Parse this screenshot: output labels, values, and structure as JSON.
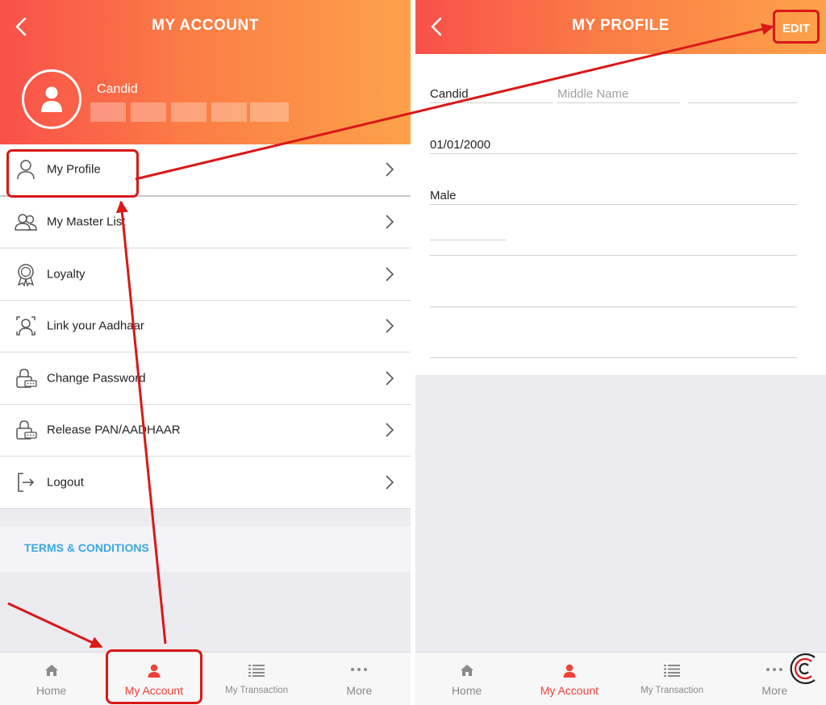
{
  "account_screen": {
    "title": "MY ACCOUNT",
    "user_name": "Candid",
    "menu": [
      {
        "label": "My Profile",
        "icon": "person-icon"
      },
      {
        "label": "My Master List",
        "icon": "users-icon"
      },
      {
        "label": "Loyalty",
        "icon": "badge-icon"
      },
      {
        "label": "Link your Aadhaar",
        "icon": "aadhaar-icon"
      },
      {
        "label": "Change Password",
        "icon": "lock-icon"
      },
      {
        "label": "Release PAN/AADHAAR",
        "icon": "lock-icon"
      },
      {
        "label": "Logout",
        "icon": "logout-icon"
      }
    ],
    "terms_label": "TERMS & CONDITIONS"
  },
  "profile_screen": {
    "title": "MY PROFILE",
    "edit_label": "EDIT",
    "first_name": "Candid",
    "middle_name_placeholder": "Middle Name",
    "dob": "01/01/2000",
    "gender": "Male"
  },
  "nav": {
    "items": [
      {
        "label": "Home",
        "icon": "home-icon"
      },
      {
        "label": "My Account",
        "icon": "account-icon"
      },
      {
        "label": "My Transaction",
        "icon": "list-icon"
      },
      {
        "label": "More",
        "icon": "more-dots-icon"
      }
    ],
    "active_index": 1
  },
  "colors": {
    "header_start": "#f9504a",
    "header_end": "#fca24a",
    "accent": "#ef4136",
    "annotation": "#d91818",
    "link": "#3aa8e0"
  }
}
